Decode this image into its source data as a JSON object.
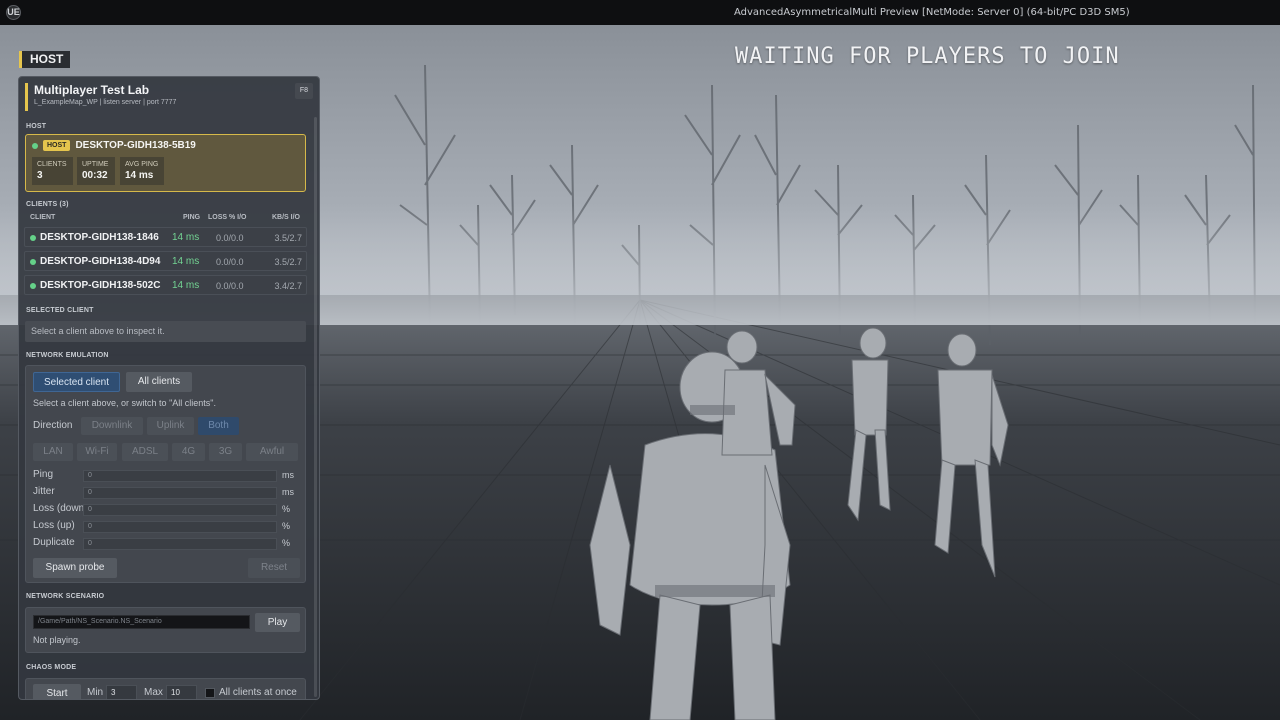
{
  "window": {
    "title": "AdvancedAsymmetricalMulti Preview [NetMode: Server 0]  (64-bit/PC D3D SM5)",
    "logo": "UE"
  },
  "overlay": {
    "waiting_text": "WAITING FOR PLAYERS TO JOIN",
    "host_tag": "HOST"
  },
  "panel": {
    "title": "Multiplayer Test Lab",
    "subtitle": "L_ExampleMap_WP  |  listen server  |  port 7777",
    "hotkey": "F8",
    "host_section": "HOST",
    "host": {
      "badge": "HOST",
      "name": "DESKTOP-GIDH138-5B19",
      "stats": [
        {
          "label": "CLIENTS",
          "value": "3"
        },
        {
          "label": "UPTIME",
          "value": "00:32"
        },
        {
          "label": "AVG PING",
          "value": "14 ms"
        }
      ]
    },
    "clients_section": "CLIENTS (3)",
    "client_columns": {
      "client": "CLIENT",
      "ping": "PING",
      "loss": "LOSS % I/O",
      "kbs": "KB/S I/O"
    },
    "clients": [
      {
        "name": "DESKTOP-GIDH138-1846",
        "ping": "14 ms",
        "loss": "0.0/0.0",
        "kbs": "3.5/2.7"
      },
      {
        "name": "DESKTOP-GIDH138-4D94",
        "ping": "14 ms",
        "loss": "0.0/0.0",
        "kbs": "3.5/2.7"
      },
      {
        "name": "DESKTOP-GIDH138-502C",
        "ping": "14 ms",
        "loss": "0.0/0.0",
        "kbs": "3.4/2.7"
      }
    ],
    "selected_section": "SELECTED CLIENT",
    "selected_placeholder": "Select a client above to inspect it.",
    "emulation_section": "NETWORK EMULATION",
    "emulation": {
      "tabs": [
        "Selected client",
        "All clients"
      ],
      "hint": "Select a client above, or switch to \"All clients\".",
      "direction_label": "Direction",
      "directions": [
        "Downlink",
        "Uplink",
        "Both"
      ],
      "presets": [
        "LAN",
        "Wi-Fi",
        "ADSL",
        "4G",
        "3G",
        "Awful"
      ],
      "fields": [
        {
          "label": "Ping",
          "value": "0",
          "unit": "ms"
        },
        {
          "label": "Jitter",
          "value": "0",
          "unit": "ms"
        },
        {
          "label": "Loss (down",
          "value": "0",
          "unit": "%"
        },
        {
          "label": "Loss (up)",
          "value": "0",
          "unit": "%"
        },
        {
          "label": "Duplicate",
          "value": "0",
          "unit": "%"
        }
      ],
      "spawn_label": "Spawn probe",
      "reset_label": "Reset"
    },
    "scenario_section": "NETWORK SCENARIO",
    "scenario": {
      "path_placeholder": "/Game/Path/NS_Scenario.NS_Scenario",
      "play_label": "Play",
      "status": "Not playing."
    },
    "chaos_section": "CHAOS MODE",
    "chaos": {
      "start_label": "Start",
      "min_label": "Min",
      "min_value": "3",
      "max_label": "Max",
      "max_value": "10",
      "all_clients_label": "All clients at once"
    }
  },
  "colors": {
    "accent_yellow": "#e5c54d",
    "ping_green": "#73d493",
    "tab_blue": "#2f4e73"
  }
}
